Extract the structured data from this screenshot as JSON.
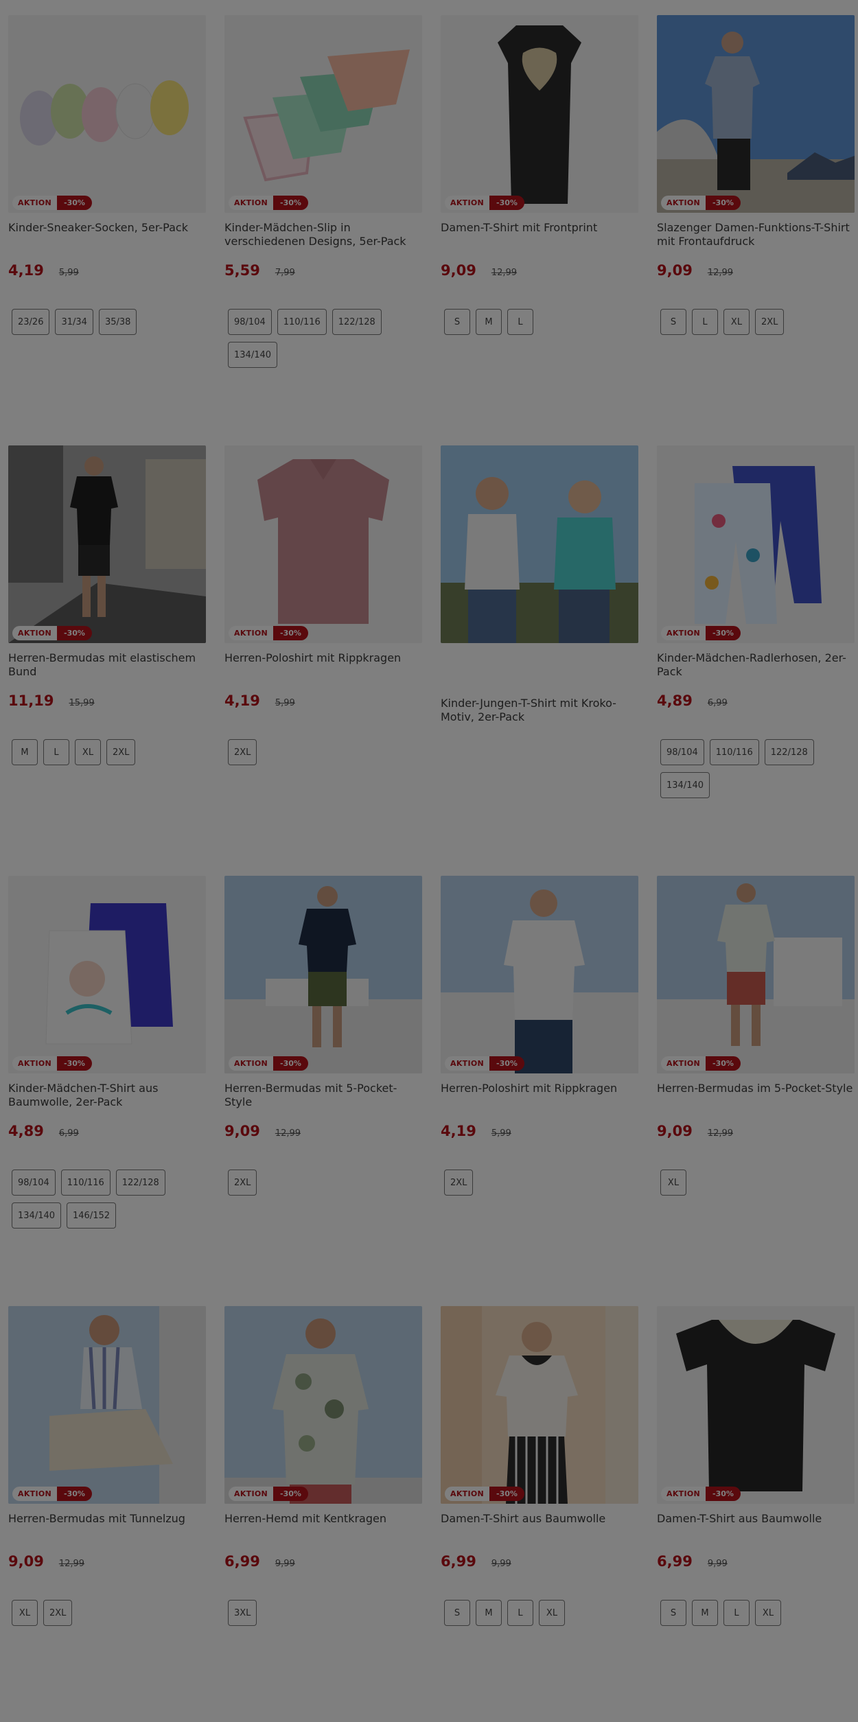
{
  "products": [
    {
      "title": "Kinder-Sneaker-Socken, 5er-Pack",
      "badge": "AKTION",
      "discount": "-30%",
      "price": "4,19",
      "old_price": "5,99",
      "sizes": [
        "23/26",
        "31/34",
        "35/38"
      ]
    },
    {
      "title": "Kinder-Mädchen-Slip in verschiedenen Designs, 5er-Pack",
      "badge": "AKTION",
      "discount": "-30%",
      "price": "5,59",
      "old_price": "7,99",
      "sizes": [
        "98/104",
        "110/116",
        "122/128",
        "134/140"
      ]
    },
    {
      "title": "Damen-T-Shirt mit Frontprint",
      "badge": "AKTION",
      "discount": "-30%",
      "price": "9,09",
      "old_price": "12,99",
      "sizes": [
        "S",
        "M",
        "L"
      ]
    },
    {
      "title": "Slazenger Damen-Funktions-T-Shirt mit Frontaufdruck",
      "badge": "AKTION",
      "discount": "-30%",
      "price": "9,09",
      "old_price": "12,99",
      "sizes": [
        "S",
        "L",
        "XL",
        "2XL"
      ]
    },
    {
      "title": "Herren-Bermudas mit elastischem Bund",
      "badge": "AKTION",
      "discount": "-30%",
      "price": "11,19",
      "old_price": "15,99",
      "sizes": [
        "M",
        "L",
        "XL",
        "2XL"
      ]
    },
    {
      "title": "Herren-Poloshirt mit Rippkragen",
      "badge": "AKTION",
      "discount": "-30%",
      "price": "4,19",
      "old_price": "5,99",
      "sizes": [
        "2XL"
      ]
    },
    {
      "title": "Kinder-Jungen-T-Shirt mit Kroko-Motiv, 2er-Pack",
      "badge": "",
      "discount": "",
      "price": "",
      "old_price": "",
      "sizes": []
    },
    {
      "title": "Kinder-Mädchen-Radlerhosen, 2er-Pack",
      "badge": "AKTION",
      "discount": "-30%",
      "price": "4,89",
      "old_price": "6,99",
      "sizes": [
        "98/104",
        "110/116",
        "122/128",
        "134/140"
      ]
    },
    {
      "title": "Kinder-Mädchen-T-Shirt aus Baumwolle, 2er-Pack",
      "badge": "AKTION",
      "discount": "-30%",
      "price": "4,89",
      "old_price": "6,99",
      "sizes": [
        "98/104",
        "110/116",
        "122/128",
        "134/140",
        "146/152"
      ]
    },
    {
      "title": "Herren-Bermudas mit 5-Pocket-Style",
      "badge": "AKTION",
      "discount": "-30%",
      "price": "9,09",
      "old_price": "12,99",
      "sizes": [
        "2XL"
      ]
    },
    {
      "title": "Herren-Poloshirt mit Rippkragen",
      "badge": "AKTION",
      "discount": "-30%",
      "price": "4,19",
      "old_price": "5,99",
      "sizes": [
        "2XL"
      ]
    },
    {
      "title": "Herren-Bermudas im 5-Pocket-Style",
      "badge": "AKTION",
      "discount": "-30%",
      "price": "9,09",
      "old_price": "12,99",
      "sizes": [
        "XL"
      ]
    },
    {
      "title": "Herren-Bermudas mit Tunnelzug",
      "badge": "AKTION",
      "discount": "-30%",
      "price": "9,09",
      "old_price": "12,99",
      "sizes": [
        "XL",
        "2XL"
      ]
    },
    {
      "title": "Herren-Hemd mit Kentkragen",
      "badge": "AKTION",
      "discount": "-30%",
      "price": "6,99",
      "old_price": "9,99",
      "sizes": [
        "3XL"
      ]
    },
    {
      "title": "Damen-T-Shirt aus Baumwolle",
      "badge": "AKTION",
      "discount": "-30%",
      "price": "6,99",
      "old_price": "9,99",
      "sizes": [
        "S",
        "M",
        "L",
        "XL"
      ]
    },
    {
      "title": "Damen-T-Shirt aus Baumwolle",
      "badge": "AKTION",
      "discount": "-30%",
      "price": "6,99",
      "old_price": "9,99",
      "sizes": [
        "S",
        "M",
        "L",
        "XL"
      ]
    }
  ],
  "colors": {
    "accent": "#b5121b",
    "overlay": "rgba(0,0,0,0.5)"
  }
}
